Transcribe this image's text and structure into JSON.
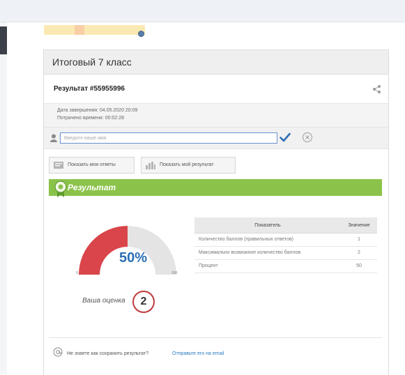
{
  "card": {
    "title": "Итоговый 7 класс",
    "result_id": "Результат #55955996",
    "completion_date": "Дата завершения: 04.05.2020 20:09",
    "time_spent": "Потрачено времени: 00:02:28"
  },
  "name_input": {
    "placeholder": "Введите ваше имя",
    "value": ""
  },
  "buttons": {
    "show_answers": "Показать мои ответы",
    "show_result": "Показать мой результат"
  },
  "result": {
    "banner_label": "Результат",
    "percent_label": "50%",
    "percent_value": 50,
    "gauge_min": "0",
    "gauge_max": "100",
    "grade_label": "Ваша оценка",
    "grade_value": "2"
  },
  "stats_table": {
    "headers": [
      "Показатель",
      "Значение"
    ],
    "rows": [
      {
        "label": "Количество баллов (правильных ответов)",
        "value": "1"
      },
      {
        "label": "Максимально возможное количество баллов",
        "value": "2"
      },
      {
        "label": "Процент",
        "value": "50"
      }
    ]
  },
  "help": {
    "question": "Не знаете как сохранить результат?",
    "link": "Отправьте его на email"
  },
  "colors": {
    "gauge_fill": "#d9454a",
    "gauge_track": "#e4e4e4",
    "banner": "#8bc34a",
    "accent_blue": "#2c6fb5",
    "grade_circle": "#c0393b"
  },
  "icons": [
    "share-icon",
    "user-icon",
    "checkmark-icon",
    "cancel-icon",
    "answers-icon",
    "chart-icon",
    "award-icon",
    "email-icon"
  ]
}
